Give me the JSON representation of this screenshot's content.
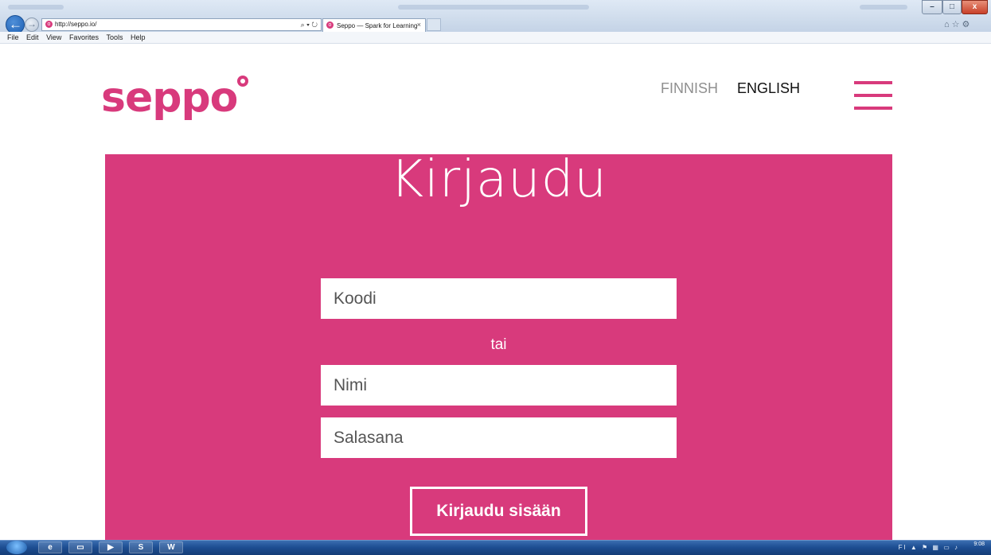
{
  "browser": {
    "url": "http://seppo.io/",
    "tab_title": "Seppo — Spark for Learning",
    "tab_close": "×",
    "menu": [
      "File",
      "Edit",
      "View",
      "Favorites",
      "Tools",
      "Help"
    ],
    "window_controls": {
      "minimize": "–",
      "maximize": "□",
      "close": "x"
    }
  },
  "header": {
    "logo_text": "seppo",
    "lang_finnish": "FINNISH",
    "lang_english": "ENGLISH",
    "accent_color": "#d83a7c"
  },
  "login": {
    "heading": "Kirjaudu",
    "code_placeholder": "Koodi",
    "or_text": "tai",
    "name_placeholder": "Nimi",
    "password_placeholder": "Salasana",
    "submit_label": "Kirjaudu sisään"
  },
  "taskbar": {
    "tray_lang": "FI",
    "clock_time": "9:08"
  }
}
